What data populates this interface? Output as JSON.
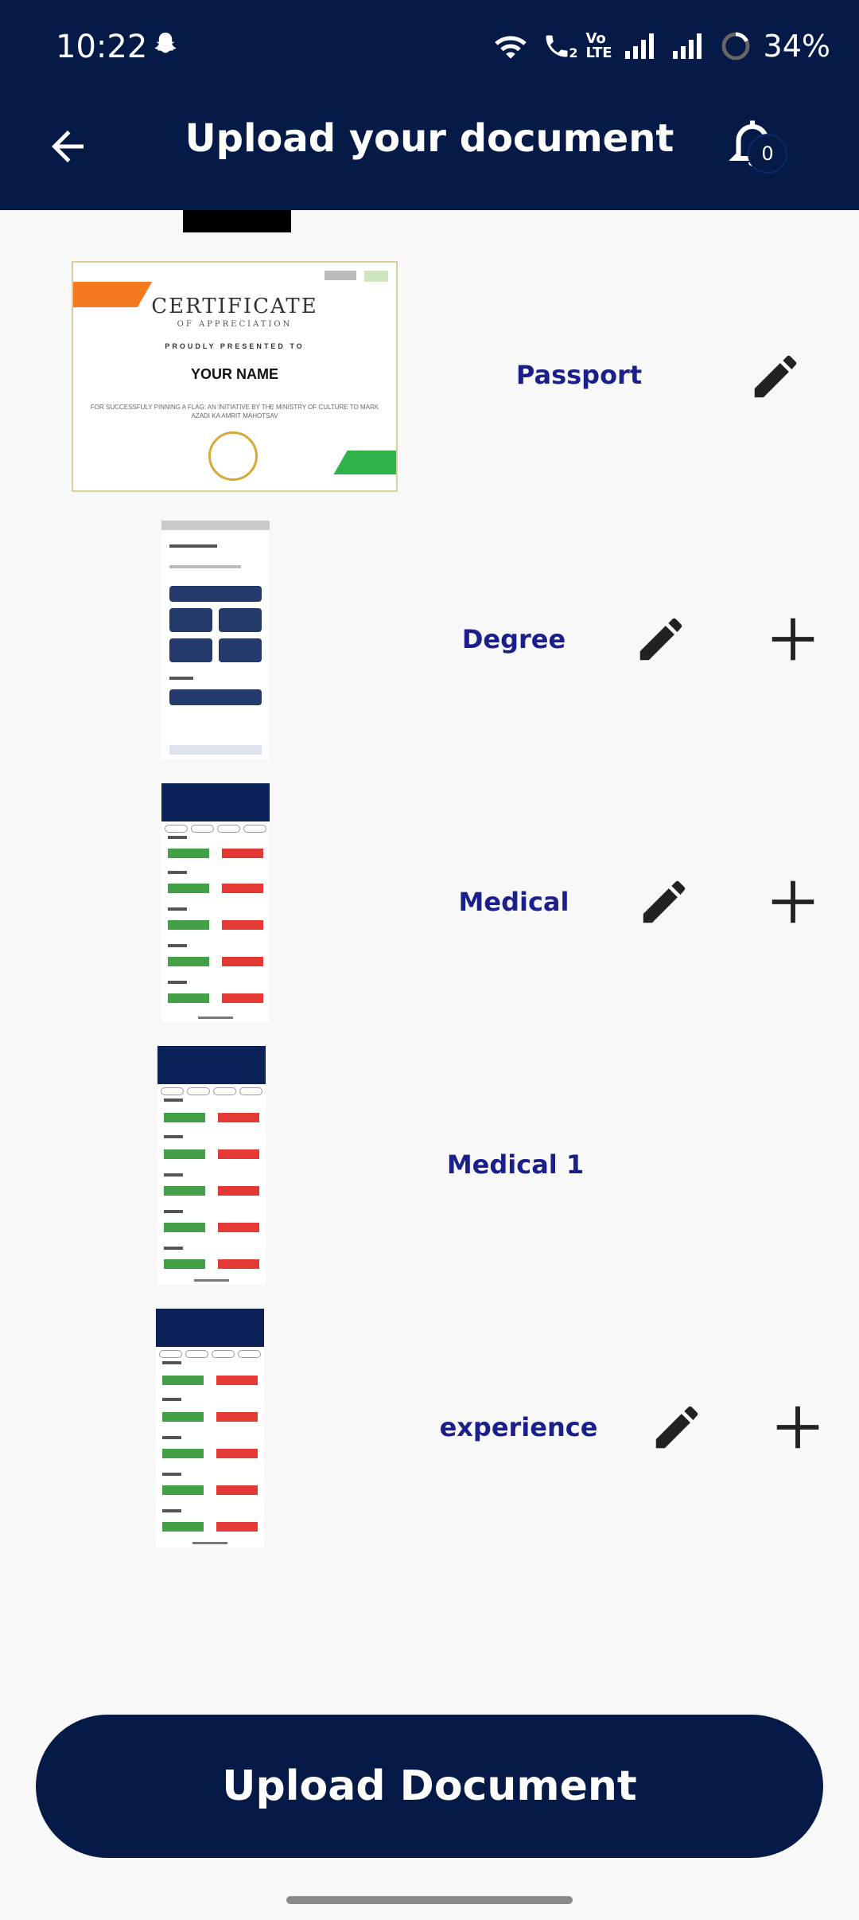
{
  "status_bar": {
    "time": "10:22",
    "battery": "34%",
    "volte": "Vo\nLTE",
    "sim": "2",
    "icons": [
      "ghost-icon",
      "wifi-icon",
      "call-icon",
      "signal-icon",
      "battery-icon"
    ]
  },
  "app_bar": {
    "title": "Upload your document",
    "notification_count": "0"
  },
  "certificate": {
    "title": "CERTIFICATE",
    "subtitle": "OF APPRECIATION",
    "presented": "PROUDLY PRESENTED TO",
    "name": "YOUR NAME",
    "body": "FOR SUCCESSFULY PINNING A FLAG: AN INITIATIVE BY THE MINISTRY OF CULTURE TO MARK AZADI KA AMRIT MAHOTSAV"
  },
  "documents": [
    {
      "label": "Passport",
      "has_edit": true,
      "has_add": false
    },
    {
      "label": "Degree",
      "has_edit": true,
      "has_add": true
    },
    {
      "label": "Medical",
      "has_edit": true,
      "has_add": true
    },
    {
      "label": "Medical 1",
      "has_edit": false,
      "has_add": false
    },
    {
      "label": "experience",
      "has_edit": true,
      "has_add": true
    }
  ],
  "upload_button": "Upload Document",
  "colors": {
    "primary": "#061a47",
    "label": "#1a1f8c",
    "background": "#f8f8f8"
  }
}
